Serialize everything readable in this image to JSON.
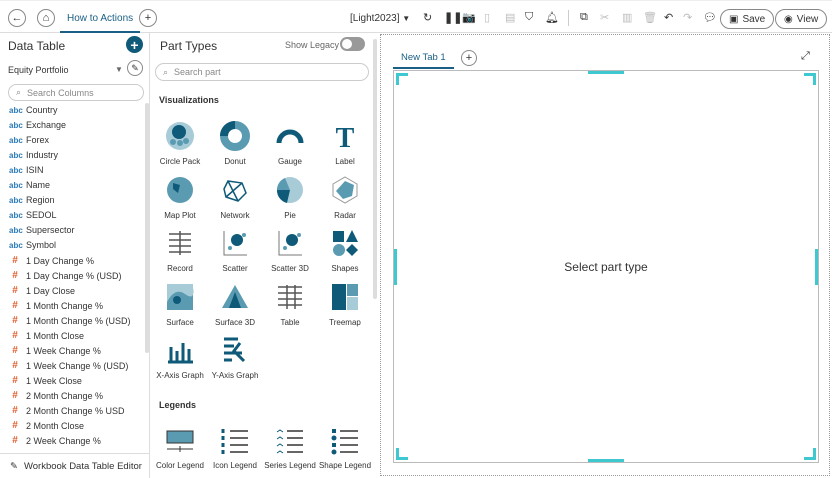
{
  "topbar": {
    "tab_label": "How to Actions",
    "theme": "[Light2023]",
    "save_label": "Save",
    "view_label": "View"
  },
  "datatable": {
    "title": "Data Table",
    "source": "Equity Portfolio",
    "search_placeholder": "Search Columns",
    "fields": [
      {
        "type": "abc",
        "name": "Country"
      },
      {
        "type": "abc",
        "name": "Exchange"
      },
      {
        "type": "abc",
        "name": "Forex"
      },
      {
        "type": "abc",
        "name": "Industry"
      },
      {
        "type": "abc",
        "name": "ISIN"
      },
      {
        "type": "abc",
        "name": "Name"
      },
      {
        "type": "abc",
        "name": "Region"
      },
      {
        "type": "abc",
        "name": "SEDOL"
      },
      {
        "type": "abc",
        "name": "Supersector"
      },
      {
        "type": "abc",
        "name": "Symbol"
      },
      {
        "type": "#",
        "name": "1 Day Change %"
      },
      {
        "type": "#",
        "name": "1 Day Change % (USD)"
      },
      {
        "type": "#",
        "name": "1 Day Close"
      },
      {
        "type": "#",
        "name": "1 Month Change %"
      },
      {
        "type": "#",
        "name": "1 Month Change % (USD)"
      },
      {
        "type": "#",
        "name": "1 Month Close"
      },
      {
        "type": "#",
        "name": "1 Week Change %"
      },
      {
        "type": "#",
        "name": "1 Week Change % (USD)"
      },
      {
        "type": "#",
        "name": "1 Week Close"
      },
      {
        "type": "#",
        "name": "2 Month Change %"
      },
      {
        "type": "#",
        "name": "2 Month Change % USD"
      },
      {
        "type": "#",
        "name": "2 Month Close"
      },
      {
        "type": "#",
        "name": "2 Week Change %"
      }
    ],
    "footer": "Workbook Data Table Editor"
  },
  "parts": {
    "title": "Part Types",
    "legacy_label": "Show Legacy",
    "search_placeholder": "Search part",
    "vis_heading": "Visualizations",
    "legends_heading": "Legends",
    "visualizations": [
      "Circle Pack",
      "Donut",
      "Gauge",
      "Label",
      "Map Plot",
      "Network",
      "Pie",
      "Radar",
      "Record",
      "Scatter",
      "Scatter 3D",
      "Shapes",
      "Surface",
      "Surface 3D",
      "Table",
      "Treemap",
      "X-Axis Graph",
      "Y-Axis Graph"
    ],
    "legends": [
      "Color Legend",
      "Icon Legend",
      "Series Legend",
      "Shape Legend"
    ]
  },
  "canvas": {
    "tab": "New Tab 1",
    "placeholder": "Select part type"
  },
  "colors": {
    "accent": "#0e5a78",
    "corner": "#40c8d0"
  }
}
